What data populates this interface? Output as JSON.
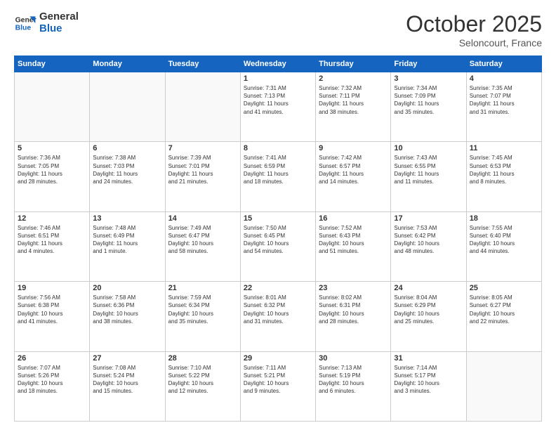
{
  "header": {
    "logo_general": "General",
    "logo_blue": "Blue",
    "month": "October 2025",
    "location": "Seloncourt, France"
  },
  "weekdays": [
    "Sunday",
    "Monday",
    "Tuesday",
    "Wednesday",
    "Thursday",
    "Friday",
    "Saturday"
  ],
  "weeks": [
    [
      {
        "day": "",
        "info": ""
      },
      {
        "day": "",
        "info": ""
      },
      {
        "day": "",
        "info": ""
      },
      {
        "day": "1",
        "info": "Sunrise: 7:31 AM\nSunset: 7:13 PM\nDaylight: 11 hours\nand 41 minutes."
      },
      {
        "day": "2",
        "info": "Sunrise: 7:32 AM\nSunset: 7:11 PM\nDaylight: 11 hours\nand 38 minutes."
      },
      {
        "day": "3",
        "info": "Sunrise: 7:34 AM\nSunset: 7:09 PM\nDaylight: 11 hours\nand 35 minutes."
      },
      {
        "day": "4",
        "info": "Sunrise: 7:35 AM\nSunset: 7:07 PM\nDaylight: 11 hours\nand 31 minutes."
      }
    ],
    [
      {
        "day": "5",
        "info": "Sunrise: 7:36 AM\nSunset: 7:05 PM\nDaylight: 11 hours\nand 28 minutes."
      },
      {
        "day": "6",
        "info": "Sunrise: 7:38 AM\nSunset: 7:03 PM\nDaylight: 11 hours\nand 24 minutes."
      },
      {
        "day": "7",
        "info": "Sunrise: 7:39 AM\nSunset: 7:01 PM\nDaylight: 11 hours\nand 21 minutes."
      },
      {
        "day": "8",
        "info": "Sunrise: 7:41 AM\nSunset: 6:59 PM\nDaylight: 11 hours\nand 18 minutes."
      },
      {
        "day": "9",
        "info": "Sunrise: 7:42 AM\nSunset: 6:57 PM\nDaylight: 11 hours\nand 14 minutes."
      },
      {
        "day": "10",
        "info": "Sunrise: 7:43 AM\nSunset: 6:55 PM\nDaylight: 11 hours\nand 11 minutes."
      },
      {
        "day": "11",
        "info": "Sunrise: 7:45 AM\nSunset: 6:53 PM\nDaylight: 11 hours\nand 8 minutes."
      }
    ],
    [
      {
        "day": "12",
        "info": "Sunrise: 7:46 AM\nSunset: 6:51 PM\nDaylight: 11 hours\nand 4 minutes."
      },
      {
        "day": "13",
        "info": "Sunrise: 7:48 AM\nSunset: 6:49 PM\nDaylight: 11 hours\nand 1 minute."
      },
      {
        "day": "14",
        "info": "Sunrise: 7:49 AM\nSunset: 6:47 PM\nDaylight: 10 hours\nand 58 minutes."
      },
      {
        "day": "15",
        "info": "Sunrise: 7:50 AM\nSunset: 6:45 PM\nDaylight: 10 hours\nand 54 minutes."
      },
      {
        "day": "16",
        "info": "Sunrise: 7:52 AM\nSunset: 6:43 PM\nDaylight: 10 hours\nand 51 minutes."
      },
      {
        "day": "17",
        "info": "Sunrise: 7:53 AM\nSunset: 6:42 PM\nDaylight: 10 hours\nand 48 minutes."
      },
      {
        "day": "18",
        "info": "Sunrise: 7:55 AM\nSunset: 6:40 PM\nDaylight: 10 hours\nand 44 minutes."
      }
    ],
    [
      {
        "day": "19",
        "info": "Sunrise: 7:56 AM\nSunset: 6:38 PM\nDaylight: 10 hours\nand 41 minutes."
      },
      {
        "day": "20",
        "info": "Sunrise: 7:58 AM\nSunset: 6:36 PM\nDaylight: 10 hours\nand 38 minutes."
      },
      {
        "day": "21",
        "info": "Sunrise: 7:59 AM\nSunset: 6:34 PM\nDaylight: 10 hours\nand 35 minutes."
      },
      {
        "day": "22",
        "info": "Sunrise: 8:01 AM\nSunset: 6:32 PM\nDaylight: 10 hours\nand 31 minutes."
      },
      {
        "day": "23",
        "info": "Sunrise: 8:02 AM\nSunset: 6:31 PM\nDaylight: 10 hours\nand 28 minutes."
      },
      {
        "day": "24",
        "info": "Sunrise: 8:04 AM\nSunset: 6:29 PM\nDaylight: 10 hours\nand 25 minutes."
      },
      {
        "day": "25",
        "info": "Sunrise: 8:05 AM\nSunset: 6:27 PM\nDaylight: 10 hours\nand 22 minutes."
      }
    ],
    [
      {
        "day": "26",
        "info": "Sunrise: 7:07 AM\nSunset: 5:26 PM\nDaylight: 10 hours\nand 18 minutes."
      },
      {
        "day": "27",
        "info": "Sunrise: 7:08 AM\nSunset: 5:24 PM\nDaylight: 10 hours\nand 15 minutes."
      },
      {
        "day": "28",
        "info": "Sunrise: 7:10 AM\nSunset: 5:22 PM\nDaylight: 10 hours\nand 12 minutes."
      },
      {
        "day": "29",
        "info": "Sunrise: 7:11 AM\nSunset: 5:21 PM\nDaylight: 10 hours\nand 9 minutes."
      },
      {
        "day": "30",
        "info": "Sunrise: 7:13 AM\nSunset: 5:19 PM\nDaylight: 10 hours\nand 6 minutes."
      },
      {
        "day": "31",
        "info": "Sunrise: 7:14 AM\nSunset: 5:17 PM\nDaylight: 10 hours\nand 3 minutes."
      },
      {
        "day": "",
        "info": ""
      }
    ]
  ]
}
